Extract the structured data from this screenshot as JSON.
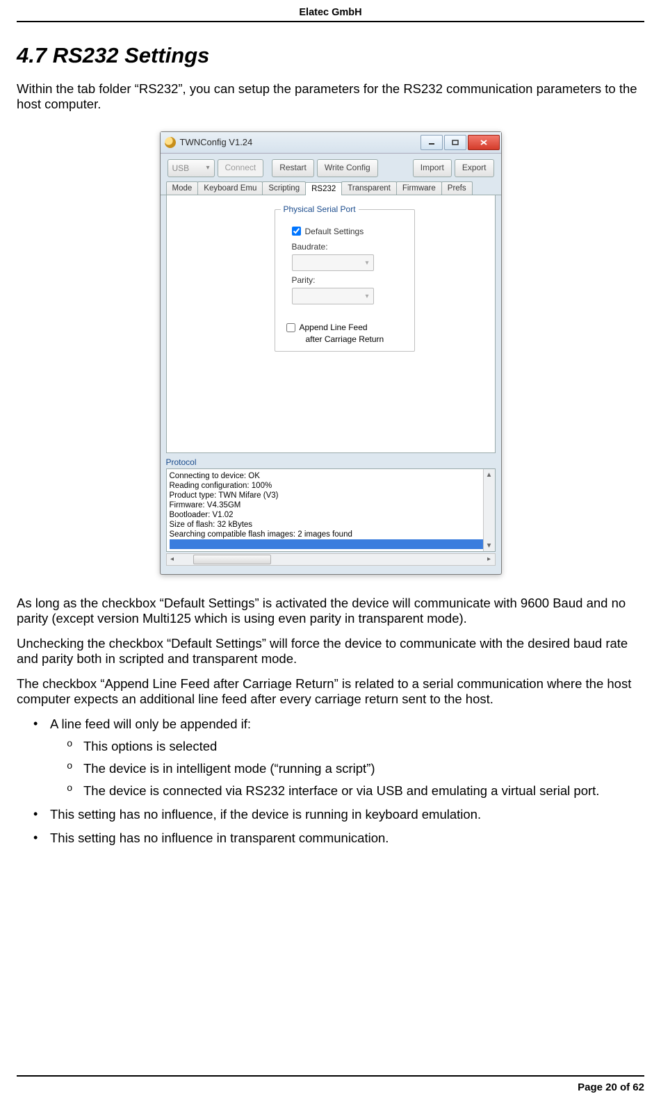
{
  "header": {
    "company": "Elatec GmbH"
  },
  "section": {
    "heading": "4.7  RS232 Settings"
  },
  "intro": "Within the tab folder “RS232”, you can setup the parameters for the RS232 communication parameters to the host computer.",
  "window": {
    "title": "TWNConfig V1.24",
    "conn_select": "USB",
    "buttons": {
      "connect": "Connect",
      "restart": "Restart",
      "write_config": "Write Config",
      "import": "Import",
      "export": "Export"
    },
    "tabs": [
      "Mode",
      "Keyboard Emu",
      "Scripting",
      "RS232",
      "Transparent",
      "Firmware",
      "Prefs"
    ],
    "active_tab_index": 3,
    "group_title": "Physical Serial Port",
    "default_settings_label": "Default Settings",
    "baudrate_label": "Baudrate:",
    "parity_label": "Parity:",
    "append_lf_label_1": "Append Line Feed",
    "append_lf_label_2": "after Carriage Return",
    "protocol_label": "Protocol",
    "protocol_lines": [
      "Connecting to device: OK",
      "Reading configuration: 100%",
      "Product type: TWN Mifare (V3)",
      "Firmware: V4.35GM",
      "Bootloader: V1.02",
      "Size of flash: 32 kBytes",
      "Searching compatible flash images: 2 images found"
    ]
  },
  "para1": "As long as the checkbox “Default Settings” is activated the device will communicate with 9600 Baud and no parity (except version Multi125 which is using even parity in transparent mode).",
  "para2": "Unchecking the checkbox “Default Settings” will force the device to communicate with the desired baud rate and parity both in scripted and transparent mode.",
  "para3": "The checkbox “Append Line Feed after Carriage Return” is related to a serial communication where the host computer expects an additional line feed after every carriage return sent to the host.",
  "bullets": {
    "b1": "A line feed will only be appended if:",
    "b1s1": "This options is selected",
    "b1s2": "The device is in intelligent mode (“running a script”)",
    "b1s3": "The device is connected via RS232 interface or via USB and emulating a virtual serial port.",
    "b2": "This setting has no influence, if the device is running in keyboard emulation.",
    "b3": "This setting has no influence in transparent communication."
  },
  "footer": {
    "page": "Page 20 of 62"
  }
}
